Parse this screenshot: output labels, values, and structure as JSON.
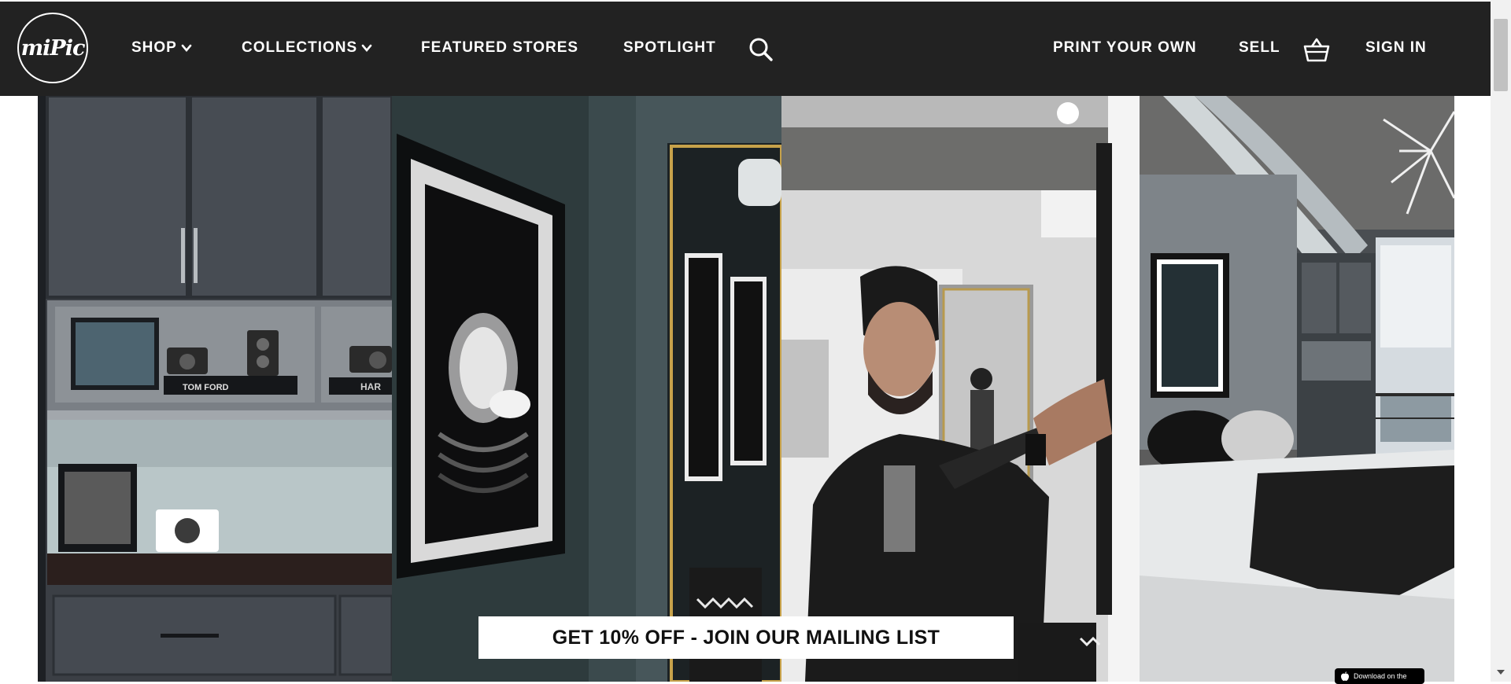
{
  "brand": {
    "logo_text": "miPic"
  },
  "nav": {
    "shop": "SHOP",
    "collections": "COLLECTIONS",
    "featured_stores": "FEATURED STORES",
    "spotlight": "SPOTLIGHT",
    "print_your_own": "PRINT YOUR OWN",
    "sell": "SELL",
    "sign_in": "SIGN IN"
  },
  "icons": {
    "search": "search-icon",
    "cart": "basket-icon",
    "dropdown": "chevron-down-icon",
    "logo": "mipic-logo"
  },
  "hero": {
    "cta_label": "GET 10% OFF - JOIN OUR MAILING LIST",
    "app_badge_text": "Download on the",
    "shelf_text_1": "TOM FORD",
    "shelf_text_2": "HAR"
  },
  "colors": {
    "nav_background": "#222222",
    "nav_text": "#ffffff",
    "cta_background": "#ffffff",
    "cta_text": "#111111"
  }
}
